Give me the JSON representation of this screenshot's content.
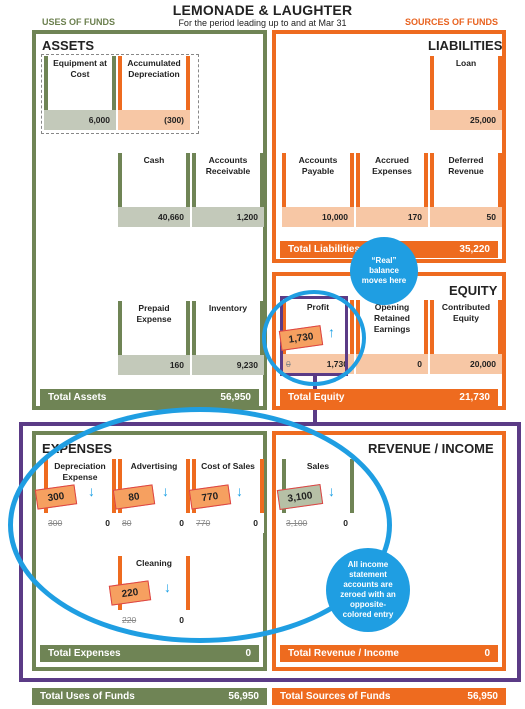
{
  "header": {
    "title": "LEMONADE & LAUGHTER",
    "subtitle": "For the period leading up to and at Mar 31",
    "uses_label": "USES OF FUNDS",
    "sources_label": "SOURCES OF FUNDS"
  },
  "assets": {
    "title": "ASSETS",
    "accounts": {
      "equipment": {
        "label": "Equipment at Cost",
        "balance": "6,000"
      },
      "accum_dep": {
        "label": "Accumulated Depreciation",
        "balance": "(300)"
      },
      "cash": {
        "label": "Cash",
        "balance": "40,660"
      },
      "receivable": {
        "label": "Accounts Receivable",
        "balance": "1,200"
      },
      "prepaid": {
        "label": "Prepaid Expense",
        "balance": "160"
      },
      "inventory": {
        "label": "Inventory",
        "balance": "9,230"
      }
    },
    "total_label": "Total Assets",
    "total_value": "56,950"
  },
  "liabilities": {
    "title": "LIABILITIES",
    "accounts": {
      "loan": {
        "label": "Loan",
        "balance": "25,000"
      },
      "payable": {
        "label": "Accounts Payable",
        "balance": "10,000"
      },
      "accrued": {
        "label": "Accrued Expenses",
        "balance": "170"
      },
      "deferred": {
        "label": "Deferred Revenue",
        "balance": "50"
      }
    },
    "total_label": "Total Liabilities",
    "total_value": "35,220"
  },
  "equity": {
    "title": "EQUITY",
    "accounts": {
      "profit": {
        "label": "Profit",
        "balance": "1,730",
        "struck": "0",
        "note": "1,730"
      },
      "opening": {
        "label": "Opening Retained Earnings",
        "balance": "0"
      },
      "contributed": {
        "label": "Contributed Equity",
        "balance": "20,000"
      }
    },
    "total_label": "Total Equity",
    "total_value": "21,730",
    "callout": "“Real” balance moves here"
  },
  "expenses": {
    "title": "EXPENSES",
    "accounts": {
      "depreciation": {
        "label": "Depreciation Expense",
        "struck": "300",
        "balance": "0",
        "note": "300"
      },
      "advertising": {
        "label": "Advertising",
        "struck": "80",
        "balance": "0",
        "note": "80"
      },
      "cost_of_sales": {
        "label": "Cost of Sales",
        "struck": "770",
        "balance": "0",
        "note": "770"
      },
      "cleaning": {
        "label": "Cleaning",
        "struck": "220",
        "balance": "0",
        "note": "220"
      }
    },
    "total_label": "Total Expenses",
    "total_value": "0"
  },
  "revenue": {
    "title": "REVENUE / INCOME",
    "accounts": {
      "sales": {
        "label": "Sales",
        "struck": "3,100",
        "balance": "0",
        "note": "3,100"
      }
    },
    "total_label": "Total Revenue / Income",
    "total_value": "0",
    "callout": "All income statement accounts are zeroed with an opposite-colored entry"
  },
  "footer": {
    "uses_label": "Total Uses of Funds",
    "uses_value": "56,950",
    "sources_label": "Total Sources of Funds",
    "sources_value": "56,950"
  }
}
